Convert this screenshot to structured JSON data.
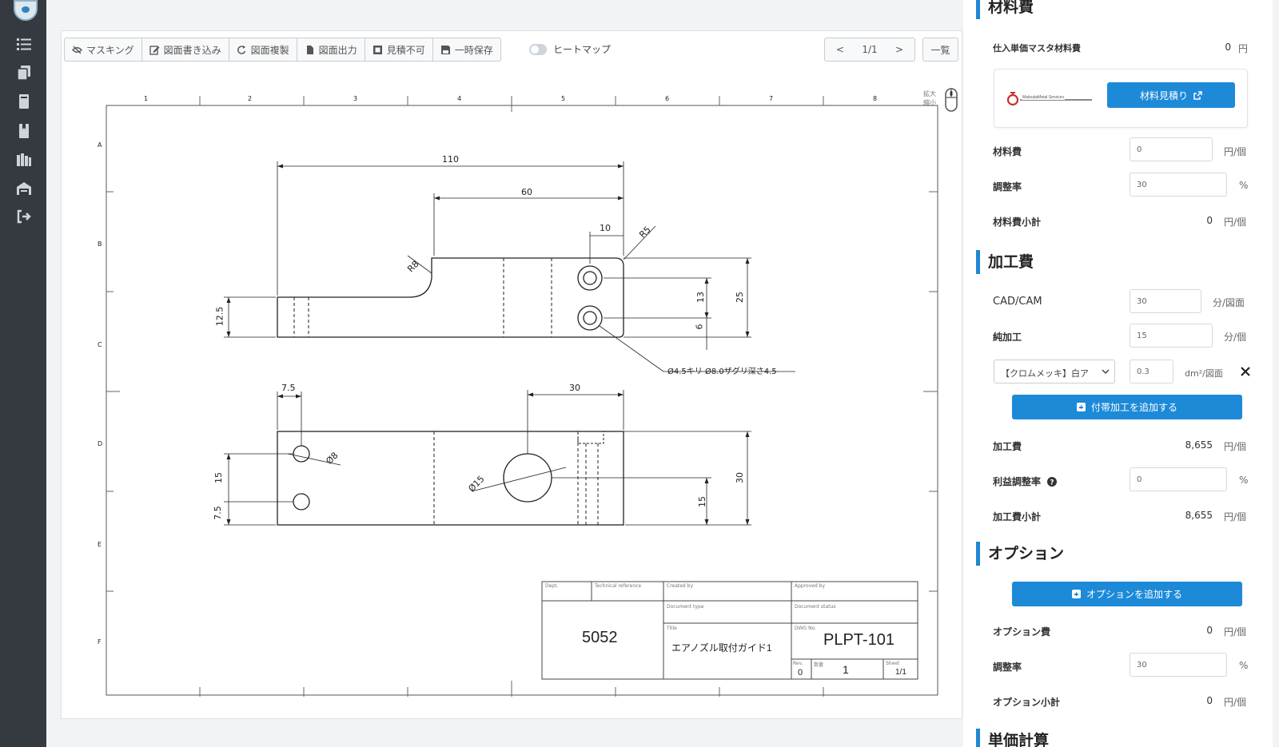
{
  "sidebar": {
    "icons": [
      "logo-icon",
      "list-icon",
      "copy-icon",
      "book-icon",
      "bookmark-icon",
      "library-icon",
      "warehouse-icon",
      "logout-icon"
    ]
  },
  "toolbar": {
    "masking": "マスキング",
    "write": "図面書き込み",
    "duplicate": "図面複製",
    "output": "図面出力",
    "no_estimate": "見積不可",
    "temp_save": "一時保存",
    "heatmap": "ヒートマップ"
  },
  "pager": {
    "prev": "<",
    "page": "1/1",
    "next": ">",
    "list": "一覧"
  },
  "zoom_hint": "拡大 縮小",
  "drawing": {
    "dims": {
      "d110": "110",
      "d60": "60",
      "d10": "10",
      "r5": "R5",
      "r8": "R8",
      "d12_5": "12.5",
      "d13": "13",
      "d6": "6",
      "d25": "25",
      "hole_note": "Ø4.5キリ Ø8.0ザグリ深さ4.5",
      "d7_5": "7.5",
      "d30": "30",
      "d8": "Ø8",
      "d15_hole": "Ø15",
      "d15a": "15",
      "d7_5b": "7.5",
      "d30v": "30",
      "d15b": "15"
    },
    "ruler": {
      "top": [
        "1",
        "2",
        "3",
        "4",
        "5",
        "6",
        "7",
        "8"
      ],
      "left": [
        "A",
        "B",
        "C",
        "D",
        "E",
        "F"
      ]
    },
    "title_block": {
      "material": "5052",
      "part_name": "エアノズル取付ガイド1",
      "part_number": "PLPT-101",
      "rev": "0",
      "quantity": "1",
      "sheet": "1/1"
    }
  },
  "panel": {
    "material": {
      "title": "材料費",
      "mask_label": "仕入単価マスタ材料費",
      "mask_value": "0",
      "mask_unit": "円",
      "sponsor": "MatsudaMetal Services",
      "estimate_button": "材料見積り",
      "cost_label": "材料費",
      "cost_value": "0",
      "cost_unit": "円/個",
      "adjust_label": "調整率",
      "adjust_value": "30",
      "adjust_unit": "%",
      "subtotal_label": "材料費小計",
      "subtotal_value": "0",
      "subtotal_unit": "円/個"
    },
    "processing": {
      "title": "加工費",
      "cadcam_label": "CAD/CAM",
      "cadcam_value": "30",
      "cadcam_unit": "分/図面",
      "pure_label": "純加工",
      "pure_value": "15",
      "pure_unit": "分/個",
      "plating_select": "【クロムメッキ】白ア",
      "plating_value": "0.3",
      "plating_unit": "dm²/図面",
      "add_button": "付帯加工を追加する",
      "cost_label": "加工費",
      "cost_value": "8,655",
      "cost_unit": "円/個",
      "profit_label": "利益調整率",
      "profit_value": "0",
      "profit_unit": "%",
      "subtotal_label": "加工費小計",
      "subtotal_value": "8,655",
      "subtotal_unit": "円/個"
    },
    "options": {
      "title": "オプション",
      "add_button": "オプションを追加する",
      "cost_label": "オプション費",
      "cost_value": "0",
      "cost_unit": "円/個",
      "adjust_label": "調整率",
      "adjust_value": "30",
      "adjust_unit": "%",
      "subtotal_label": "オプション小計",
      "subtotal_value": "0",
      "subtotal_unit": "円/個"
    },
    "unit_price": {
      "title": "単価計算"
    }
  },
  "colors": {
    "accent": "#1d8ad8",
    "sidebar": "#343a40"
  }
}
